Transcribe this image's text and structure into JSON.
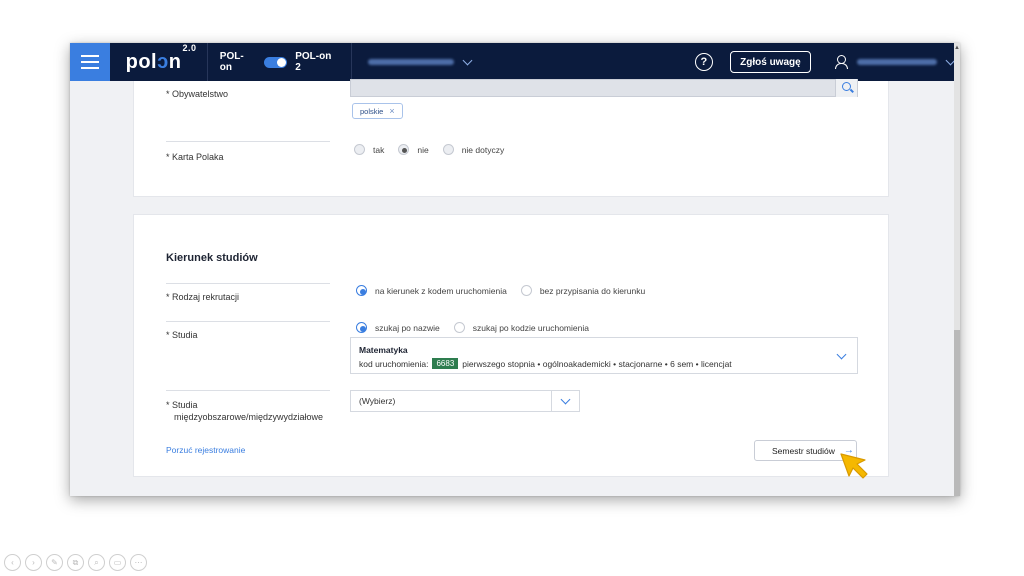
{
  "topbar": {
    "logo": "pol",
    "logo_o": "ɔ",
    "logo_n": "n",
    "logo_version": "2.0",
    "pol_on_label": "POL-on",
    "pol_on_2_label": "POL-on 2",
    "help_label": "?",
    "report_button": "Zgłoś uwagę"
  },
  "card1": {
    "citizenship_label": "* Obywatelstwo",
    "citizenship_tag": "polskie",
    "tag_remove": "×",
    "karta_label": "* Karta Polaka",
    "karta_options": [
      "tak",
      "nie",
      "nie dotyczy"
    ]
  },
  "card2": {
    "title": "Kierunek studiów",
    "recruitment_label": "* Rodzaj rekrutacji",
    "recruitment_options": [
      "na kierunek z kodem uruchomienia",
      "bez przypisania do kierunku"
    ],
    "studies_label": "* Studia",
    "studies_options": [
      "szukaj po nazwie",
      "szukaj po kodzie uruchomienia"
    ],
    "study_name": "Matematyka",
    "code_prefix": "kod uruchomienia:",
    "code_value": "6683",
    "study_details": "pierwszego stopnia • ogólnoakademicki • stacjonarne • 6 sem • licencjat",
    "interdisciplinary_label_1": "* Studia",
    "interdisciplinary_label_2": "międzyobszarowe/międzywydziałowe",
    "select_placeholder": "(Wybierz)",
    "abandon_link": "Porzuć rejestrowanie",
    "next_button": "Semestr studiów",
    "next_arrow": "→"
  },
  "toolbar_icons": [
    "prev-icon",
    "next-icon",
    "pen-icon",
    "copy-icon",
    "zoom-icon",
    "caption-icon",
    "more-icon"
  ],
  "colors": {
    "topbar_bg": "#0b1b3d",
    "accent": "#3a7ee0",
    "code_badge": "#2e7d4f"
  }
}
